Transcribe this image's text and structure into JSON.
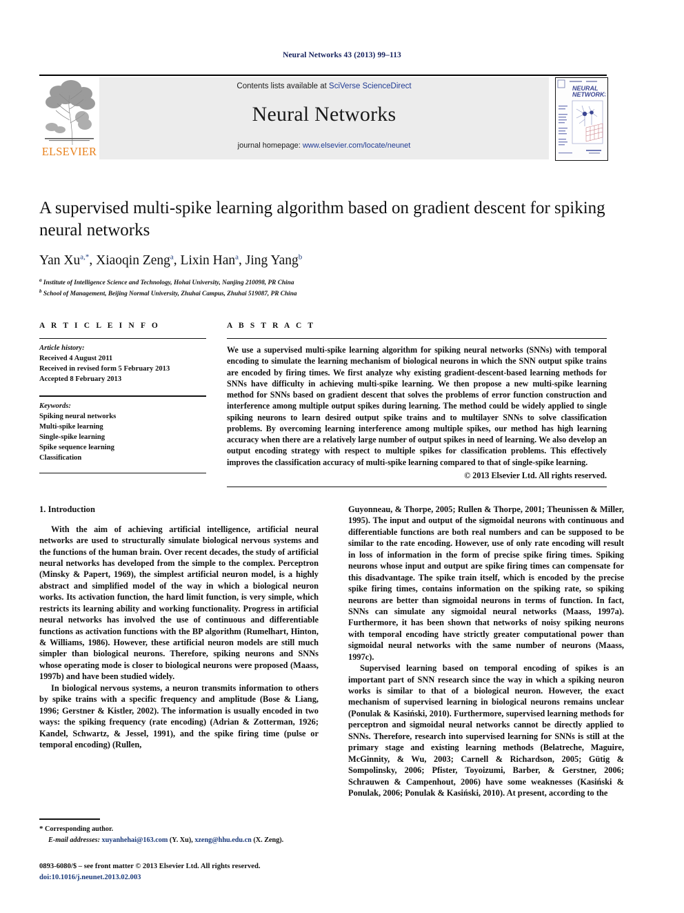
{
  "running_head": "Neural Networks 43 (2013) 99–113",
  "masthead": {
    "publisher_logo_name": "ELSEVIER",
    "contents_prefix": "Contents lists available at ",
    "contents_link": "SciVerse ScienceDirect",
    "journal_title": "Neural Networks",
    "homepage_prefix": "journal homepage: ",
    "homepage_link": "www.elsevier.com/locate/neunet",
    "cover_title_line1": "NEURAL",
    "cover_title_line2": "NETWORKS"
  },
  "article": {
    "title": "A supervised multi-spike learning algorithm based on gradient descent for spiking neural networks",
    "authors": [
      {
        "name": "Yan Xu",
        "marks": "a,*"
      },
      {
        "name": "Xiaoqin Zeng",
        "marks": "a"
      },
      {
        "name": "Lixin Han",
        "marks": "a"
      },
      {
        "name": "Jing Yang",
        "marks": "b"
      }
    ],
    "affiliations": [
      {
        "mark": "a",
        "text": "Institute of Intelligence Science and Technology, Hohai University, Nanjing 210098, PR China"
      },
      {
        "mark": "b",
        "text": "School of Management, Beijing Normal University, Zhuhai Campus, Zhuhai 519087, PR China"
      }
    ]
  },
  "article_info": {
    "heading": "A R T I C L E   I N F O",
    "history_label": "Article history:",
    "history": [
      "Received 4 August 2011",
      "Received in revised form 5 February 2013",
      "Accepted 8 February 2013"
    ],
    "keywords_label": "Keywords:",
    "keywords": [
      "Spiking neural networks",
      "Multi-spike learning",
      "Single-spike learning",
      "Spike sequence learning",
      "Classification"
    ]
  },
  "abstract": {
    "heading": "A B S T R A C T",
    "text": "We use a supervised multi-spike learning algorithm for spiking neural networks (SNNs) with temporal encoding to simulate the learning mechanism of biological neurons in which the SNN output spike trains are encoded by firing times. We first analyze why existing gradient-descent-based learning methods for SNNs have difficulty in achieving multi-spike learning. We then propose a new multi-spike learning method for SNNs based on gradient descent that solves the problems of error function construction and interference among multiple output spikes during learning. The method could be widely applied to single spiking neurons to learn desired output spike trains and to multilayer SNNs to solve classification problems. By overcoming learning interference among multiple spikes, our method has high learning accuracy when there are a relatively large number of output spikes in need of learning. We also develop an output encoding strategy with respect to multiple spikes for classification problems. This effectively improves the classification accuracy of multi-spike learning compared to that of single-spike learning.",
    "copyright": "© 2013 Elsevier Ltd. All rights reserved."
  },
  "body": {
    "section_number_title": "1.  Introduction",
    "left_paragraph_1": "With the aim of achieving artificial intelligence, artificial neural networks are used to structurally simulate biological nervous systems and the functions of the human brain. Over recent decades, the study of artificial neural networks has developed from the simple to the complex. Perceptron (Minsky & Papert, 1969), the simplest artificial neuron model, is a highly abstract and simplified model of the way in which a biological neuron works. Its activation function, the hard limit function, is very simple, which restricts its learning ability and working functionality. Progress in artificial neural networks has involved the use of continuous and differentiable functions as activation functions with the BP algorithm (Rumelhart, Hinton, & Williams, 1986). However, these artificial neuron models are still much simpler than biological neurons. Therefore, spiking neurons and SNNs whose operating mode is closer to biological neurons were proposed (Maass, 1997b) and have been studied widely.",
    "left_paragraph_2": "In biological nervous systems, a neuron transmits information to others by spike trains with a specific frequency and amplitude (Bose & Liang, 1996; Gerstner & Kistler, 2002). The information is usually encoded in two ways: the spiking frequency (rate encoding) (Adrian & Zotterman, 1926; Kandel, Schwartz, & Jessel, 1991), and the spike firing time (pulse or temporal encoding) (Rullen,",
    "right_paragraph_1": "Guyonneau, & Thorpe, 2005; Rullen & Thorpe, 2001; Theunissen & Miller, 1995). The input and output of the sigmoidal neurons with continuous and differentiable functions are both real numbers and can be supposed to be similar to the rate encoding. However, use of only rate encoding will result in loss of information in the form of precise spike firing times. Spiking neurons whose input and output are spike firing times can compensate for this disadvantage. The spike train itself, which is encoded by the precise spike firing times, contains information on the spiking rate, so spiking neurons are better than sigmoidal neurons in terms of function. In fact, SNNs can simulate any sigmoidal neural networks (Maass, 1997a). Furthermore, it has been shown that networks of noisy spiking neurons with temporal encoding have strictly greater computational power than sigmoidal neural networks with the same number of neurons (Maass, 1997c).",
    "right_paragraph_2": "Supervised learning based on temporal encoding of spikes is an important part of SNN research since the way in which a spiking neuron works is similar to that of a biological neuron. However, the exact mechanism of supervised learning in biological neurons remains unclear (Ponulak & Kasiński, 2010). Furthermore, supervised learning methods for perceptron and sigmoidal neural networks cannot be directly applied to SNNs. Therefore, research into supervised learning for SNNs is still at the primary stage and existing learning methods (Belatreche, Maguire, McGinnity, & Wu, 2003; Carnell & Richardson, 2005; Gütig & Sompolinsky, 2006; Pfister, Toyoizumi, Barber, & Gerstner, 2006; Schrauwen & Campenhout, 2006) have some weaknesses (Kasiński & Ponulak, 2006; Ponulak & Kasiński, 2010). At present, according to the"
  },
  "footnote": {
    "corresponding_marker": "*",
    "corresponding_text": "Corresponding author.",
    "email_label": "E-mail addresses:",
    "email_1": "xuyanhehai@163.com",
    "email_1_owner": "(Y. Xu),",
    "email_2": "xzeng@hhu.edu.cn",
    "email_2_owner": "(X. Zeng)."
  },
  "bottom": {
    "front_matter": "0893-6080/$ – see front matter © 2013 Elsevier Ltd. All rights reserved.",
    "doi": "doi:10.1016/j.neunet.2013.02.003"
  },
  "colors": {
    "link_blue": "#1f3a93",
    "citation_blue": "#1b3a7a",
    "running_head_navy": "#14205c",
    "elsevier_orange": "#E8821E",
    "band_gray": "#ececec"
  }
}
